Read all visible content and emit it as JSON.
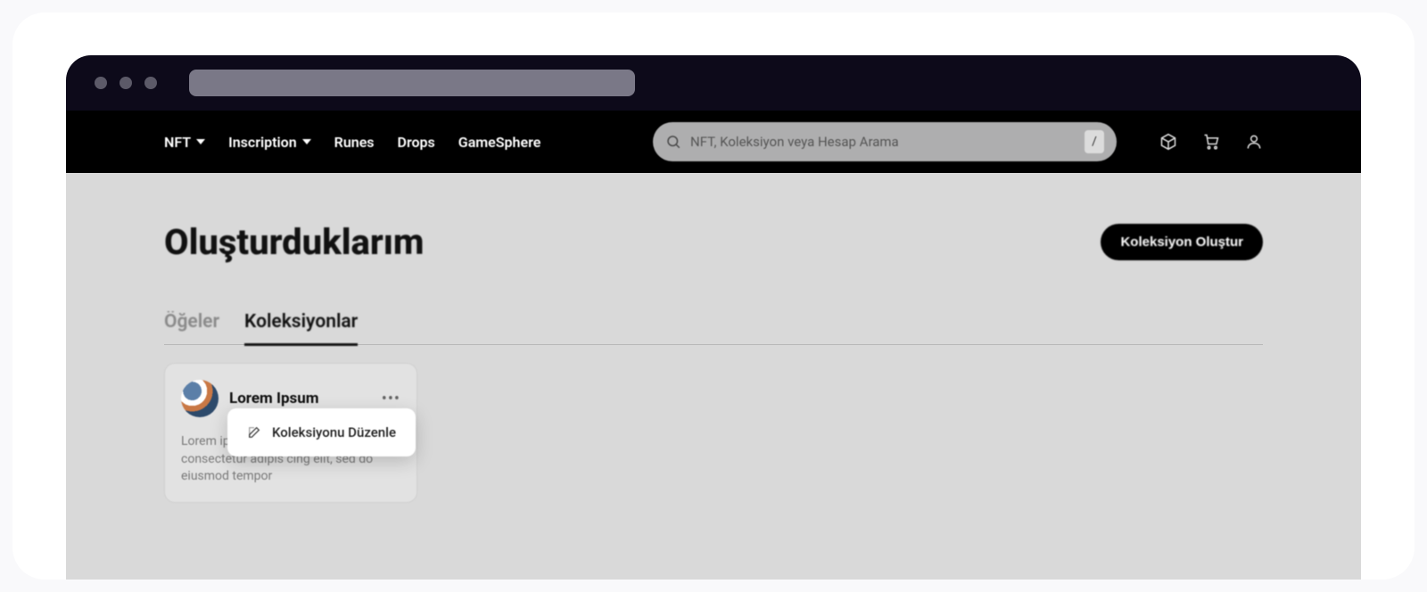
{
  "nav": {
    "items": [
      {
        "label": "NFT",
        "hasDropdown": true
      },
      {
        "label": "Inscription",
        "hasDropdown": true
      },
      {
        "label": "Runes",
        "hasDropdown": false
      },
      {
        "label": "Drops",
        "hasDropdown": false
      },
      {
        "label": "GameSphere",
        "hasDropdown": false
      }
    ]
  },
  "search": {
    "placeholder": "NFT, Koleksiyon veya Hesap Arama",
    "shortcut": "/"
  },
  "page": {
    "title": "Oluşturduklarım",
    "createButton": "Koleksiyon Oluştur"
  },
  "tabs": {
    "items": [
      {
        "label": "Öğeler",
        "active": false
      },
      {
        "label": "Koleksiyonlar",
        "active": true
      }
    ]
  },
  "collection": {
    "title": "Lorem Ipsum",
    "description": "Lorem ipsum dolor sit amet, consectetur adipis cing elit, sed do eiusmod tempor"
  },
  "popup": {
    "editLabel": "Koleksiyonu Düzenle"
  }
}
